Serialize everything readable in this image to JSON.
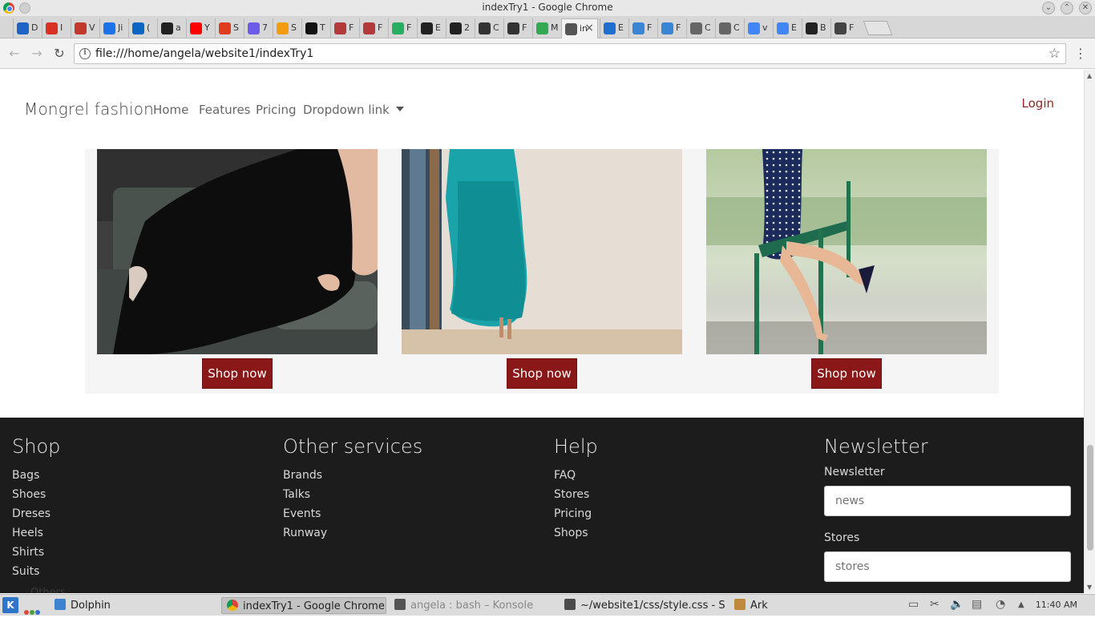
{
  "window": {
    "title": "indexTry1 - Google Chrome"
  },
  "tabs": [
    {
      "icon": "onedrive-icon",
      "label": "D",
      "color": "#1e63c5"
    },
    {
      "icon": "gmail-icon",
      "label": "I",
      "color": "#d93025"
    },
    {
      "icon": "swoosh-icon",
      "label": "V",
      "color": "#c0392b"
    },
    {
      "icon": "info-icon",
      "label": "Ji",
      "color": "#1a73e8"
    },
    {
      "icon": "linkedin-icon",
      "label": "(",
      "color": "#0a66c2"
    },
    {
      "icon": "bb-icon",
      "label": "a",
      "color": "#222222"
    },
    {
      "icon": "youtube-icon",
      "label": "Y",
      "color": "#ff0000"
    },
    {
      "icon": "m-icon",
      "label": "S",
      "color": "#e03d1e"
    },
    {
      "icon": "pocket-icon",
      "label": "7",
      "color": "#6c5ce7"
    },
    {
      "icon": "asterisk-icon",
      "label": "S",
      "color": "#f39c12"
    },
    {
      "icon": "medium-icon",
      "label": "T",
      "color": "#111111"
    },
    {
      "icon": "pin-icon",
      "label": "F",
      "color": "#b33a3a"
    },
    {
      "icon": "pin-icon",
      "label": "F",
      "color": "#b33a3a"
    },
    {
      "icon": "pinwheel-icon",
      "label": "F",
      "color": "#27ae60"
    },
    {
      "icon": "diamond-icon",
      "label": "E",
      "color": "#222222"
    },
    {
      "icon": "f-icon",
      "label": "2",
      "color": "#222222"
    },
    {
      "icon": "codepen-icon",
      "label": "C",
      "color": "#333333"
    },
    {
      "icon": "codepen-icon",
      "label": "F",
      "color": "#333333"
    },
    {
      "icon": "maps-icon",
      "label": "M",
      "color": "#34a853"
    },
    {
      "icon": "page-icon",
      "label": "in",
      "color": "#555555"
    },
    {
      "icon": "bootstrap-icon",
      "label": "E",
      "color": "#1f6fd1"
    },
    {
      "icon": "code-icon",
      "label": "F",
      "color": "#3b86d4"
    },
    {
      "icon": "code-icon",
      "label": "F",
      "color": "#3b86d4"
    },
    {
      "icon": "doc-icon",
      "label": "C",
      "color": "#666666"
    },
    {
      "icon": "doc-icon",
      "label": "C",
      "color": "#666666"
    },
    {
      "icon": "google-icon",
      "label": "v",
      "color": "#4285f4"
    },
    {
      "icon": "google-icon",
      "label": "E",
      "color": "#4285f4"
    },
    {
      "icon": "b-icon",
      "label": "B",
      "color": "#222222"
    },
    {
      "icon": "x-icon",
      "label": "F",
      "color": "#444444"
    }
  ],
  "address_bar": {
    "url": "file:///home/angela/website1/indexTry1"
  },
  "site": {
    "brand": "Mongrel fashion",
    "nav": [
      "Home",
      "Features",
      "Pricing",
      "Dropdown link"
    ],
    "login": "Login"
  },
  "products": [
    {
      "image": "black-dress-photo",
      "button": "Shop now"
    },
    {
      "image": "teal-dress-photo",
      "button": "Shop now"
    },
    {
      "image": "polka-dot-dress-photo",
      "button": "Shop now"
    }
  ],
  "footer": {
    "shop": {
      "heading": "Shop",
      "links": [
        "Bags",
        "Shoes",
        "Dreses",
        "Heels",
        "Shirts",
        "Suits"
      ],
      "overflow": "Others"
    },
    "services": {
      "heading": "Other services",
      "links": [
        "Brands",
        "Talks",
        "Events",
        "Runway"
      ]
    },
    "help": {
      "heading": "Help",
      "links": [
        "FAQ",
        "Stores",
        "Pricing",
        "Shops"
      ]
    },
    "newsletter": {
      "heading": "Newsletter",
      "label1": "Newsletter",
      "placeholder1": "news",
      "label2": "Stores",
      "placeholder2": "stores"
    }
  },
  "colors": {
    "accent": "#8a1818",
    "footer_bg": "#1d1c1c",
    "login": "#8e2a25"
  },
  "taskbar": {
    "tasks": [
      {
        "label": "Dolphin",
        "icon": "dolphin-icon"
      },
      {
        "label": "indexTry1 - Google Chrome",
        "icon": "chrome-icon"
      },
      {
        "label": "angela : bash – Konsole",
        "icon": "konsole-icon"
      },
      {
        "label": "~/website1/css/style.css - S",
        "icon": "sublime-icon"
      },
      {
        "label": "Ark",
        "icon": "ark-icon"
      }
    ],
    "clock": "11:40 AM"
  }
}
